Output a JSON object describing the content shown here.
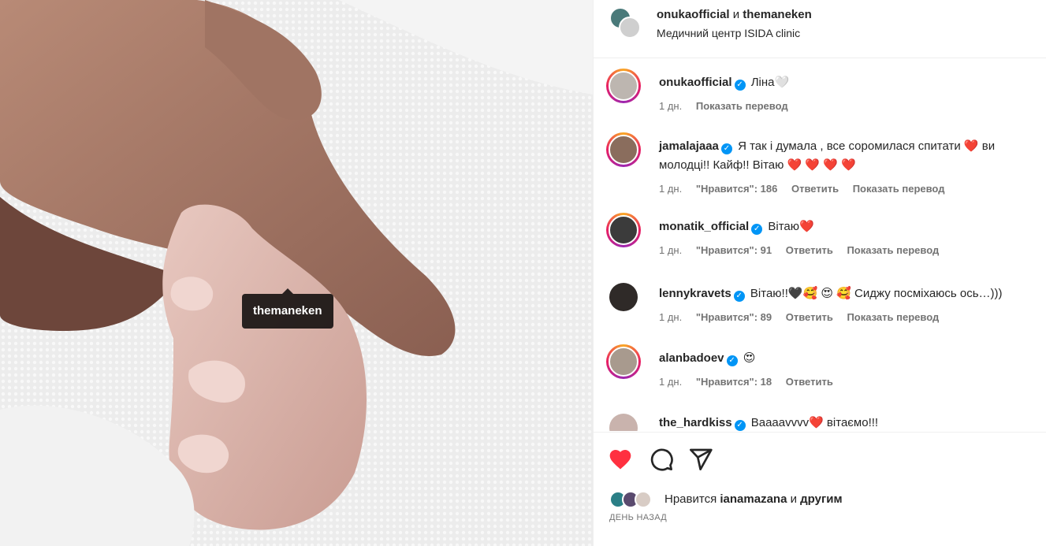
{
  "photo": {
    "tag_label": "themaneken"
  },
  "header": {
    "user1": "onukaofficial",
    "joiner": "и",
    "user2": "themaneken",
    "location": "Медичний центр ISIDA clinic"
  },
  "comments": [
    {
      "user": "onukaofficial",
      "text": "Ліна",
      "emoji": "🤍",
      "time": "1 дн.",
      "likes": "",
      "reply": "",
      "translate": "Показать перевод"
    },
    {
      "user": "jamalajaaa",
      "text": "Я так і думала , все соромилася спитати ❤️ ви молодці!! Кайф!! Вітаю ❤️ ❤️ ❤️ ❤️",
      "time": "1 дн.",
      "likes": "\"Нравится\": 186",
      "reply": "Ответить",
      "translate": "Показать перевод"
    },
    {
      "user": "monatik_official",
      "text": "Вітаю❤️",
      "time": "1 дн.",
      "likes": "\"Нравится\": 91",
      "reply": "Ответить",
      "translate": "Показать перевод"
    },
    {
      "user": "lennykravets",
      "text": "Вітаю!!🖤🥰 😍 🥰 Сиджу посміхаюсь ось…)))",
      "time": "1 дн.",
      "likes": "\"Нравится\": 89",
      "reply": "Ответить",
      "translate": "Показать перевод"
    },
    {
      "user": "alanbadoev",
      "text": "😍",
      "time": "1 дн.",
      "likes": "\"Нравится\": 18",
      "reply": "Ответить",
      "translate": ""
    },
    {
      "user": "the_hardkiss",
      "text": "Вааааvvvv❤️ вітаємо!!!",
      "time": "",
      "likes": "",
      "reply": "",
      "translate": ""
    }
  ],
  "actions": {
    "like_icon": "heart-filled-icon",
    "comment_icon": "comment-icon",
    "share_icon": "send-icon",
    "liked_color": "#ff3040"
  },
  "likes": {
    "prefix": "Нравится",
    "user": "ianamazana",
    "joiner": "и",
    "others": "другим"
  },
  "date": "ДЕНЬ НАЗАД"
}
